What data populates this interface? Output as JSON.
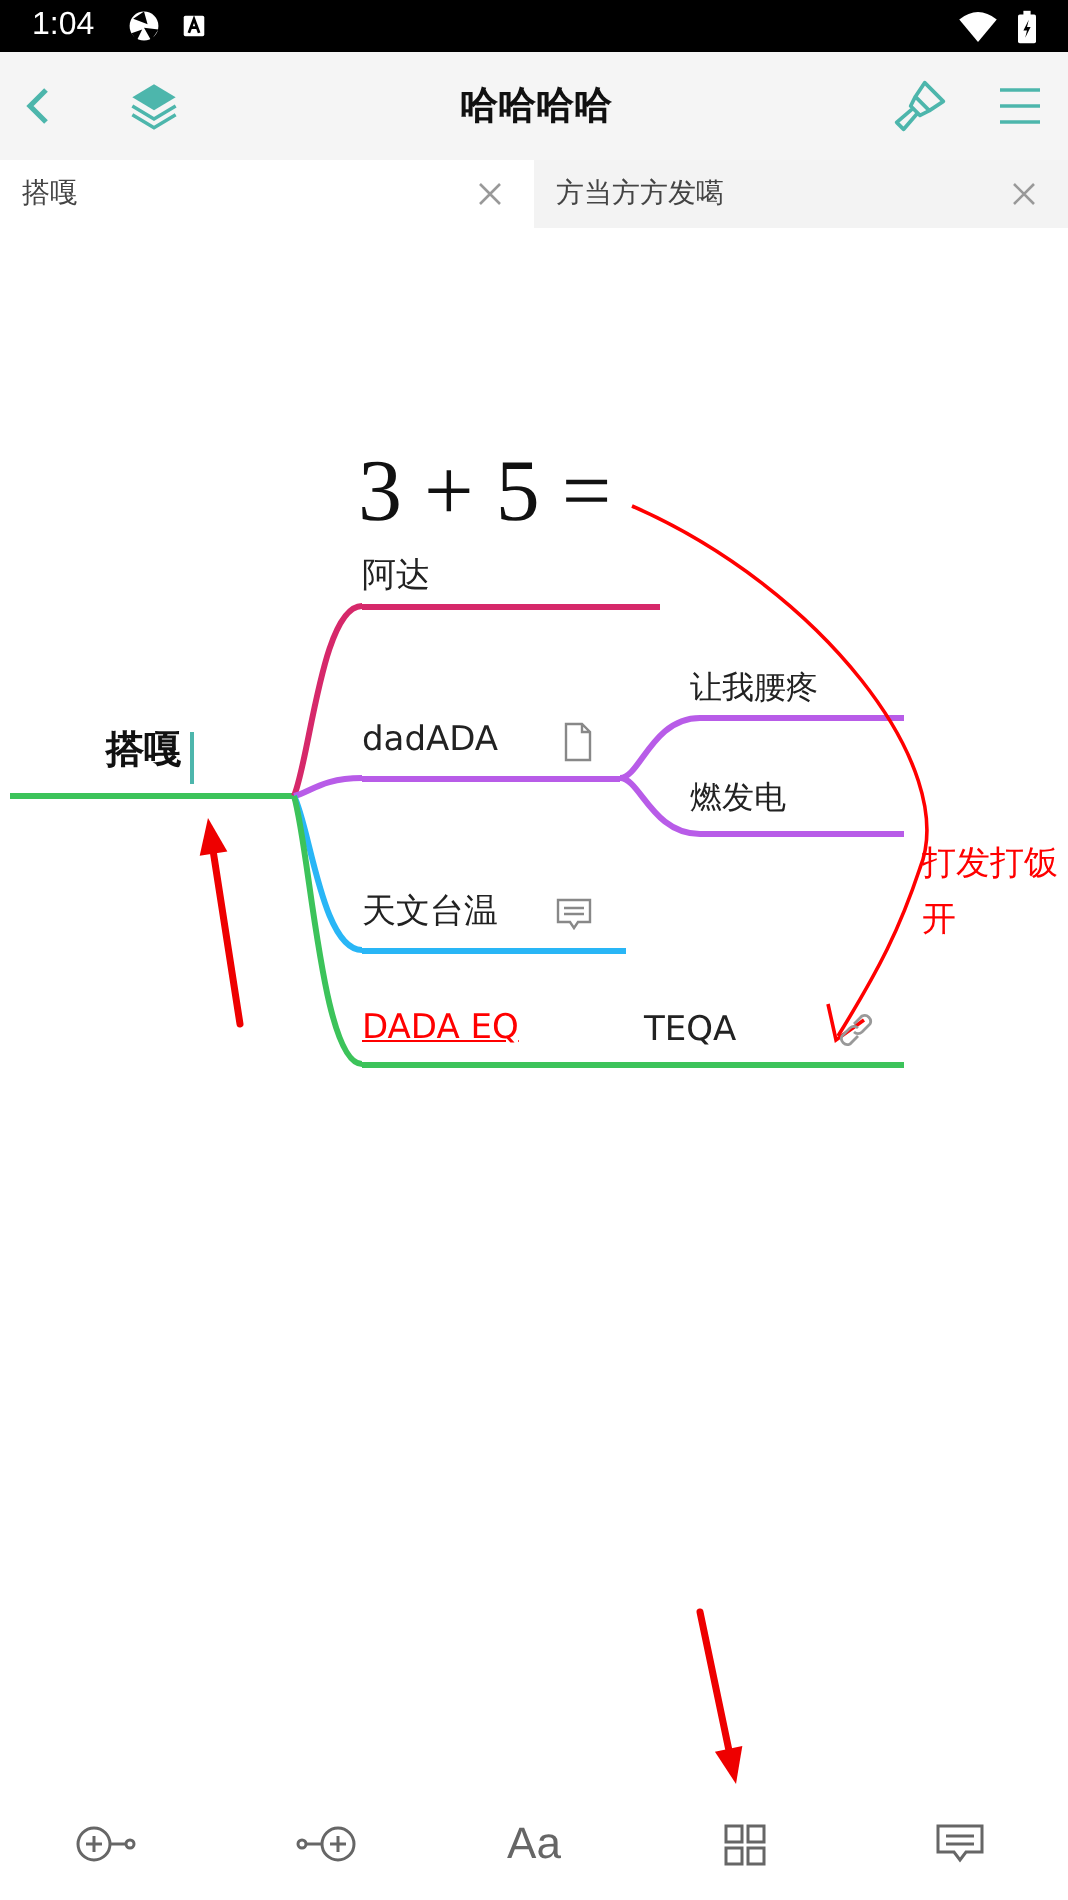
{
  "status_bar": {
    "time": "1:04"
  },
  "header": {
    "title": "哈哈哈哈"
  },
  "tabs": [
    {
      "label": "搭嘎",
      "selected": true
    },
    {
      "label": "方当方方发噶",
      "selected": false
    }
  ],
  "mindmap": {
    "root": {
      "text": "搭嘎",
      "editing": true
    },
    "branches": [
      {
        "text": "阿达",
        "formula": "3 + 5 =",
        "color": "#d6286a",
        "hyperlink": false,
        "has_note": false,
        "has_comment": false,
        "has_link": false
      },
      {
        "text": "dadADA",
        "color": "#b85ce8",
        "hyperlink": false,
        "has_note": true,
        "has_comment": false,
        "has_link": false,
        "children": [
          {
            "text": "让我腰疼"
          },
          {
            "text": "燃发电"
          }
        ]
      },
      {
        "text": "天文台温",
        "color": "#29b6f6",
        "hyperlink": false,
        "has_note": false,
        "has_comment": true,
        "has_link": false
      },
      {
        "text": "DADA EQ",
        "hyperlink": true,
        "tag": "TEQA",
        "color": "#3cc35a",
        "has_note": false,
        "has_comment": false,
        "has_link": true
      }
    ],
    "relation": {
      "label": "打发打饭开"
    }
  },
  "toolbar": [
    {
      "kind": "add-before"
    },
    {
      "kind": "add-after"
    },
    {
      "kind": "text",
      "label": "Aa"
    },
    {
      "kind": "layout"
    },
    {
      "kind": "outline"
    }
  ]
}
